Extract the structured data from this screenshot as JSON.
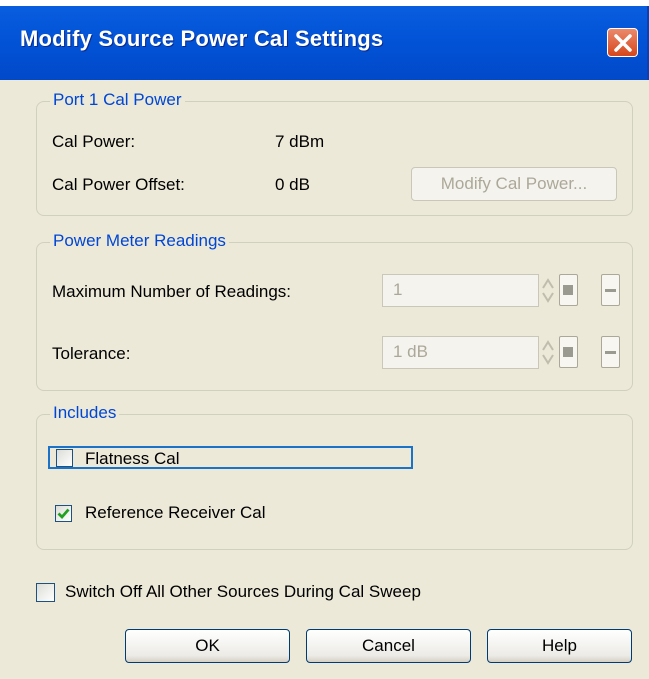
{
  "window": {
    "title": "Modify Source Power Cal Settings"
  },
  "port_group": {
    "legend": "Port 1 Cal Power",
    "cal_power_label": "Cal Power:",
    "cal_power_value": "7 dBm",
    "offset_label": "Cal Power Offset:",
    "offset_value": "0 dB",
    "modify_button": "Modify Cal Power..."
  },
  "meter_group": {
    "legend": "Power Meter Readings",
    "max_readings_label": "Maximum Number of Readings:",
    "max_readings_value": "1",
    "tolerance_label": "Tolerance:",
    "tolerance_value": "1 dB"
  },
  "includes_group": {
    "legend": "Includes",
    "flatness_label": "Flatness Cal",
    "flatness_checked": false,
    "reference_label": "Reference Receiver Cal",
    "reference_checked": true
  },
  "switch_off_label": "Switch Off All Other Sources During Cal Sweep",
  "switch_off_checked": false,
  "buttons": {
    "ok": "OK",
    "cancel": "Cancel",
    "help": "Help"
  }
}
